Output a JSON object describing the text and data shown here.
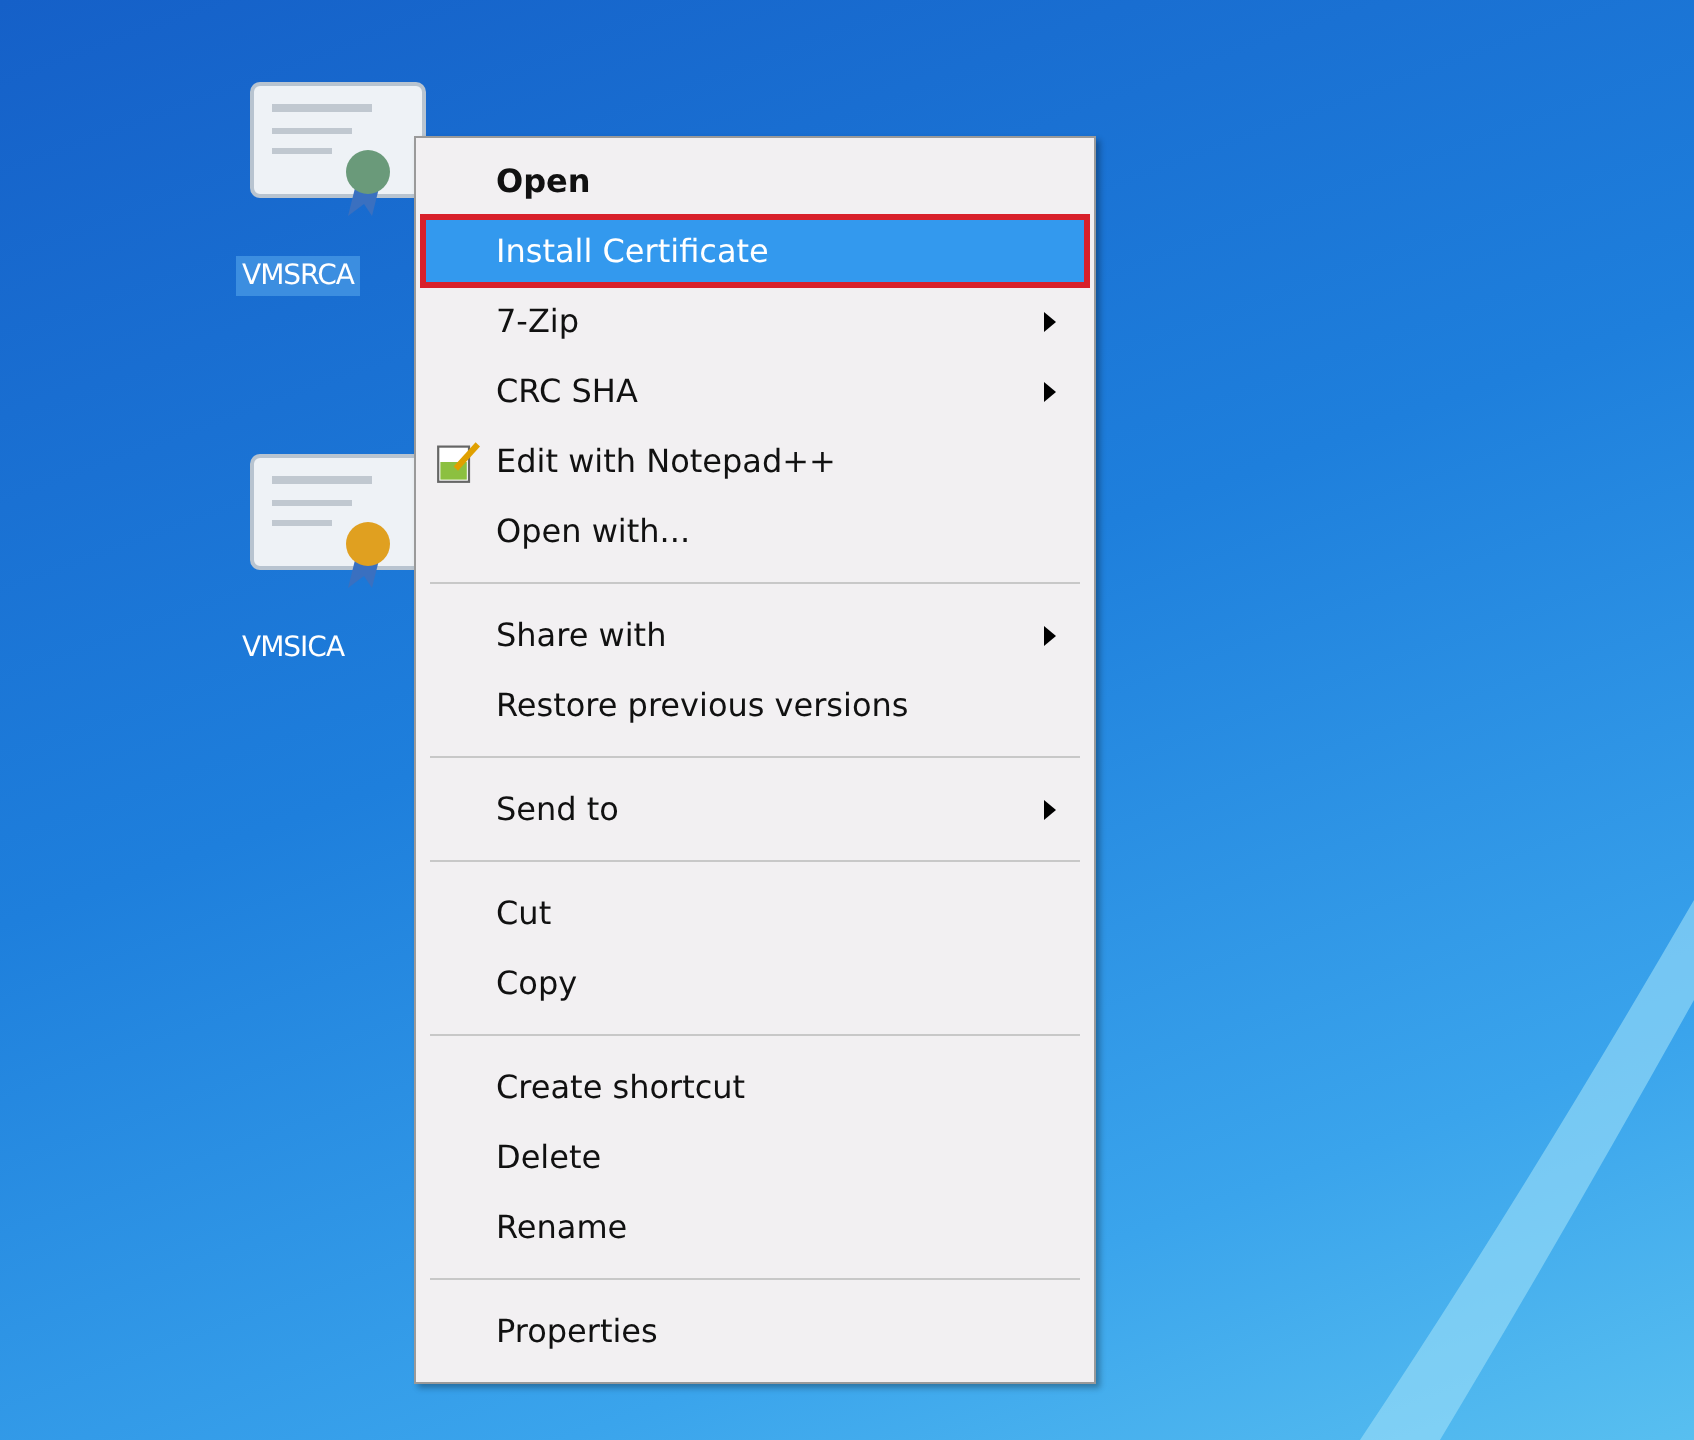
{
  "desktop_icons": [
    {
      "label": "VMSRCA",
      "selected": true,
      "color": "#6a9a7a"
    },
    {
      "label": "VMSICA",
      "selected": false,
      "color": "#e0a020"
    }
  ],
  "context_menu": {
    "groups": [
      [
        {
          "label": "Open",
          "bold": true,
          "selected": false,
          "submenu": false,
          "icon": false,
          "annotated": false
        },
        {
          "label": "Install Certificate",
          "bold": false,
          "selected": true,
          "submenu": false,
          "icon": false,
          "annotated": true
        },
        {
          "label": "7-Zip",
          "bold": false,
          "selected": false,
          "submenu": true,
          "icon": false,
          "annotated": false
        },
        {
          "label": "CRC SHA",
          "bold": false,
          "selected": false,
          "submenu": true,
          "icon": false,
          "annotated": false
        },
        {
          "label": "Edit with Notepad++",
          "bold": false,
          "selected": false,
          "submenu": false,
          "icon": true,
          "annotated": false
        },
        {
          "label": "Open with...",
          "bold": false,
          "selected": false,
          "submenu": false,
          "icon": false,
          "annotated": false
        }
      ],
      [
        {
          "label": "Share with",
          "bold": false,
          "selected": false,
          "submenu": true,
          "icon": false,
          "annotated": false
        },
        {
          "label": "Restore previous versions",
          "bold": false,
          "selected": false,
          "submenu": false,
          "icon": false,
          "annotated": false
        }
      ],
      [
        {
          "label": "Send to",
          "bold": false,
          "selected": false,
          "submenu": true,
          "icon": false,
          "annotated": false
        }
      ],
      [
        {
          "label": "Cut",
          "bold": false,
          "selected": false,
          "submenu": false,
          "icon": false,
          "annotated": false
        },
        {
          "label": "Copy",
          "bold": false,
          "selected": false,
          "submenu": false,
          "icon": false,
          "annotated": false
        }
      ],
      [
        {
          "label": "Create shortcut",
          "bold": false,
          "selected": false,
          "submenu": false,
          "icon": false,
          "annotated": false
        },
        {
          "label": "Delete",
          "bold": false,
          "selected": false,
          "submenu": false,
          "icon": false,
          "annotated": false
        },
        {
          "label": "Rename",
          "bold": false,
          "selected": false,
          "submenu": false,
          "icon": false,
          "annotated": false
        }
      ],
      [
        {
          "label": "Properties",
          "bold": false,
          "selected": false,
          "submenu": false,
          "icon": false,
          "annotated": false
        }
      ]
    ]
  }
}
